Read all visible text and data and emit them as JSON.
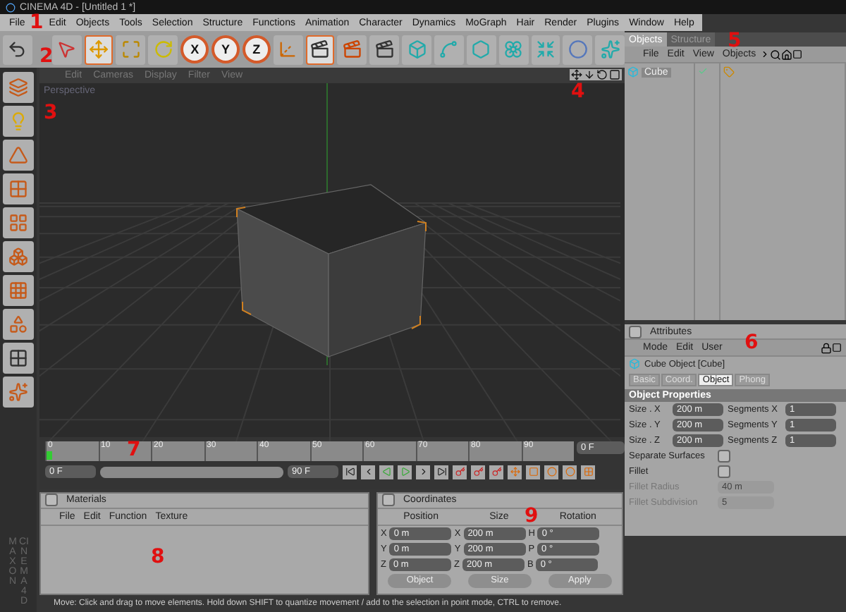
{
  "window": {
    "title": "CINEMA 4D - [Untitled 1 *]"
  },
  "menu": [
    "File",
    "Edit",
    "Objects",
    "Tools",
    "Selection",
    "Structure",
    "Functions",
    "Animation",
    "Character",
    "Dynamics",
    "MoGraph",
    "Hair",
    "Render",
    "Plugins",
    "Window",
    "Help"
  ],
  "axis_locks": [
    "X",
    "Y",
    "Z"
  ],
  "viewport": {
    "menu": [
      "Edit",
      "Cameras",
      "Display",
      "Filter",
      "View"
    ],
    "label": "Perspective"
  },
  "object_manager": {
    "tabs": [
      {
        "label": "Objects",
        "selected": true
      },
      {
        "label": "Structure",
        "selected": false
      }
    ],
    "menu": [
      "File",
      "Edit",
      "View",
      "Objects"
    ],
    "objects": [
      {
        "name": "Cube"
      }
    ]
  },
  "attributes": {
    "title": "Attributes",
    "menu": [
      "Mode",
      "Edit",
      "User"
    ],
    "object": "Cube Object [Cube]",
    "tabs": [
      {
        "label": "Basic",
        "selected": false
      },
      {
        "label": "Coord.",
        "selected": false
      },
      {
        "label": "Object",
        "selected": true
      },
      {
        "label": "Phong",
        "selected": false
      }
    ],
    "section": "Object Properties",
    "params": [
      {
        "label": "Size . X",
        "value": "200 m",
        "label2": "Segments X",
        "value2": "1"
      },
      {
        "label": "Size . Y",
        "value": "200 m",
        "label2": "Segments Y",
        "value2": "1"
      },
      {
        "label": "Size . Z",
        "value": "200 m",
        "label2": "Segments Z",
        "value2": "1"
      }
    ],
    "options": [
      {
        "label": "Separate Surfaces",
        "checked": false
      },
      {
        "label": "Fillet",
        "checked": false
      }
    ],
    "fillet": [
      {
        "label": "Fillet Radius",
        "value": "40 m",
        "disabled": true
      },
      {
        "label": "Fillet Subdivision",
        "value": "5",
        "disabled": true
      }
    ]
  },
  "timeline": {
    "ticks": [
      "0",
      "10",
      "20",
      "30",
      "40",
      "50",
      "60",
      "70",
      "80",
      "90"
    ],
    "current": "0 F",
    "start": "0 F",
    "end": "90 F",
    "range": {
      "level": 1
    }
  },
  "materials": {
    "title": "Materials",
    "menu": [
      "File",
      "Edit",
      "Function",
      "Texture"
    ]
  },
  "coordinates": {
    "title": "Coordinates",
    "headers": [
      "Position",
      "Size",
      "Rotation"
    ],
    "rows": [
      {
        "axis": "X",
        "position": "0 m",
        "size_axis": "X",
        "size": "200 m",
        "rot_axis": "H",
        "rotation": "0 °"
      },
      {
        "axis": "Y",
        "position": "0 m",
        "size_axis": "Y",
        "size": "200 m",
        "rot_axis": "P",
        "rotation": "0 °"
      },
      {
        "axis": "Z",
        "position": "0 m",
        "size_axis": "Z",
        "size": "200 m",
        "rot_axis": "B",
        "rotation": "0 °"
      }
    ],
    "dropdowns": [
      "Object",
      "Size"
    ],
    "button": "Apply"
  },
  "status_bar": "Move: Click and drag to move elements. Hold down SHIFT to quantize movement / add to the selection in point mode, CTRL to remove.",
  "logo": [
    "MAXON",
    "CINEMA 4D"
  ],
  "annotations": [
    "1",
    "2",
    "3",
    "4",
    "5",
    "6",
    "7",
    "8",
    "9"
  ]
}
